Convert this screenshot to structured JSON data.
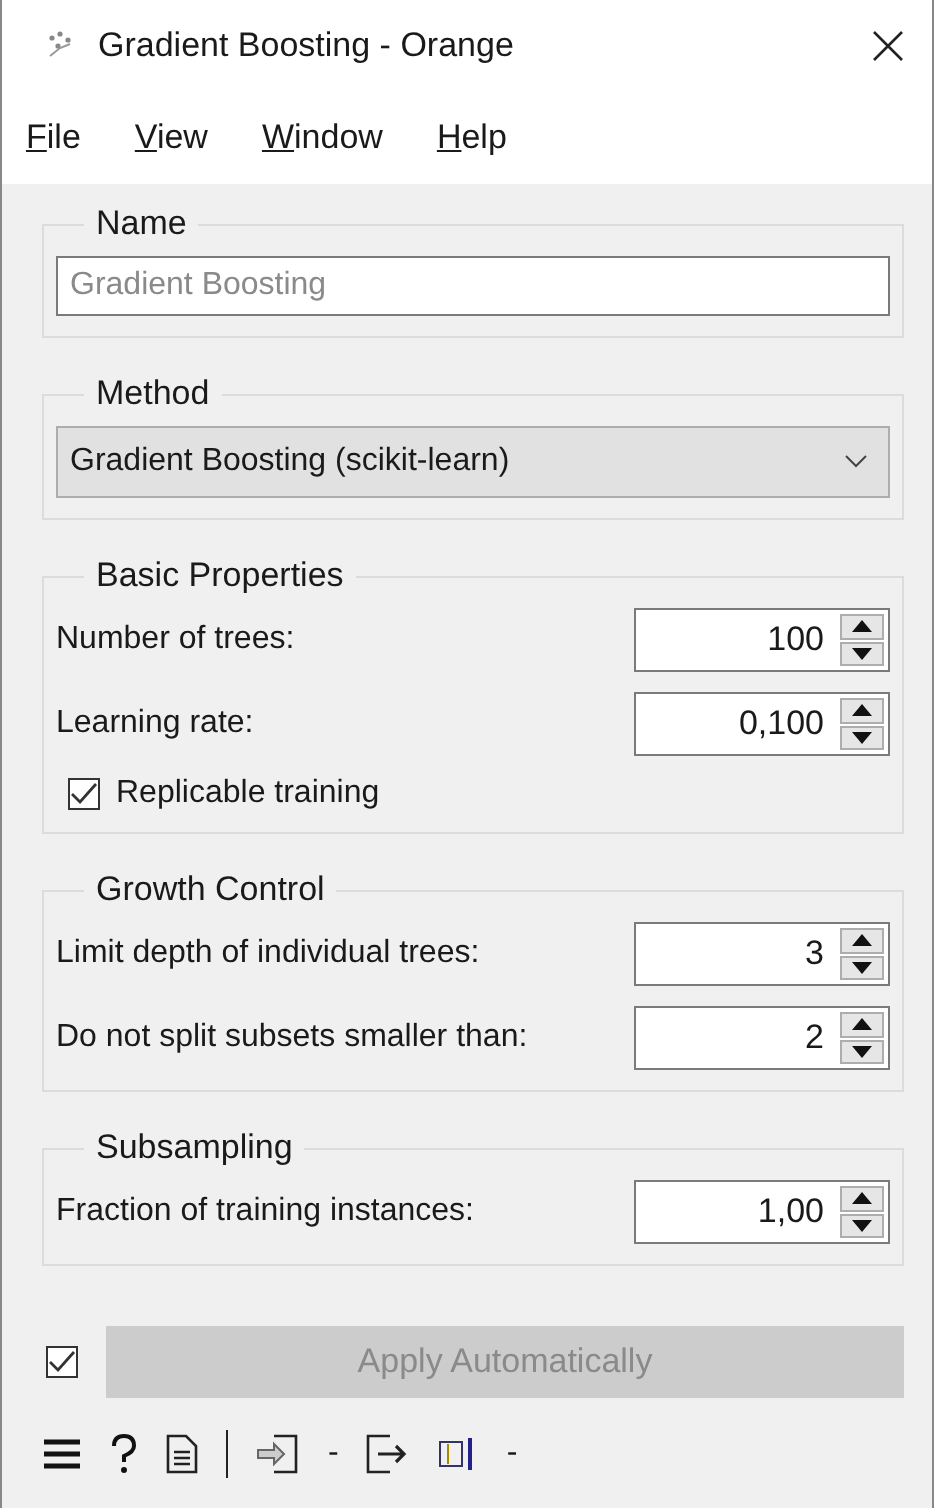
{
  "window": {
    "title": "Gradient Boosting - Orange"
  },
  "menu": [
    "File",
    "View",
    "Window",
    "Help"
  ],
  "name_group": {
    "title": "Name",
    "field": {
      "placeholder": "Gradient Boosting"
    }
  },
  "method_group": {
    "title": "Method",
    "dropdown": "Gradient Boosting (scikit-learn)"
  },
  "groups": [
    {
      "title": "Basic Properties",
      "rows": [
        {
          "kind": "spin",
          "label": "Number of trees:",
          "value": "100"
        },
        {
          "kind": "spin",
          "label": "Learning rate:",
          "value": "0,100"
        },
        {
          "kind": "check",
          "label": "Replicable training",
          "checked": true
        }
      ]
    },
    {
      "title": "Growth Control",
      "rows": [
        {
          "kind": "spin",
          "label": "Limit depth of individual trees:",
          "value": "3"
        },
        {
          "kind": "spin",
          "label": "Do not split subsets smaller than:",
          "value": "2"
        }
      ]
    },
    {
      "title": "Subsampling",
      "rows": [
        {
          "kind": "spin",
          "label": "Fraction of training instances:",
          "value": "1,00"
        }
      ]
    }
  ],
  "apply": {
    "checked": true,
    "label": "Apply Automatically",
    "disabled": true
  },
  "status_bar": {
    "input_count": "-",
    "output_count": "-"
  }
}
